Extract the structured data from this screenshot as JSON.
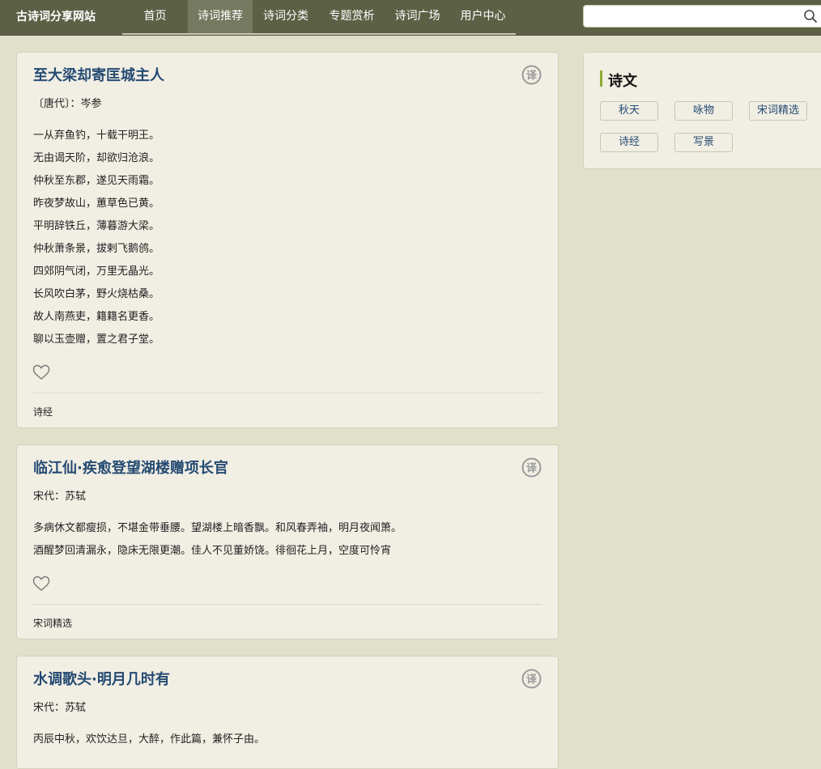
{
  "header": {
    "logo": "古诗词分享网站",
    "nav": [
      "首页",
      "诗词推荐",
      "诗词分类",
      "专题赏析",
      "诗词广场",
      "用户中心"
    ],
    "active_nav": "诗词推荐",
    "search_placeholder": ""
  },
  "poems": [
    {
      "title": "至大梁却寄匡城主人",
      "meta": "〔唐代〕：岑参",
      "lines": [
        "一从弃鱼钓，十载干明王。",
        "无由谒天阶，却欲归沧浪。",
        "仲秋至东郡，遂见天雨霜。",
        "昨夜梦故山，蕙草色已黄。",
        "平明辞铁丘，薄暮游大梁。",
        "仲秋萧条景，拔剌飞鹅鸧。",
        "四郊阴气闭，万里无晶光。",
        "长风吹白茅，野火烧枯桑。",
        "故人南燕吏，籍籍名更香。",
        "聊以玉壶赠，置之君子堂。"
      ],
      "tag": "诗经"
    },
    {
      "title": "临江仙·疾愈登望湖楼赠项长官",
      "meta": "宋代：苏轼",
      "lines": [
        "多病休文都瘦损，不堪金带垂腰。望湖楼上暗香飘。和风春弄袖，明月夜闻箫。",
        "酒醒梦回清漏永，隐床无限更潮。佳人不见董娇饶。徘徊花上月，空度可怜宵"
      ],
      "tag": "宋词精选"
    },
    {
      "title": "水调歌头·明月几时有",
      "meta": "宋代：苏轼",
      "lines": [
        "丙辰中秋，欢饮达旦，大醉，作此篇，兼怀子由。"
      ],
      "tag": ""
    }
  ],
  "sidebar": {
    "title": "诗文",
    "tags": [
      "秋天",
      "咏物",
      "宋词精选",
      "诗经",
      "写景"
    ]
  },
  "icons": {
    "search": "search-icon",
    "translate": "translate-yi-icon",
    "like": "heart-icon"
  },
  "colors": {
    "header_bg": "#5c6146",
    "page_bg": "#e1e0c9",
    "card_bg": "#f1eee4",
    "title": "#254b72",
    "accent": "#8dab34"
  }
}
